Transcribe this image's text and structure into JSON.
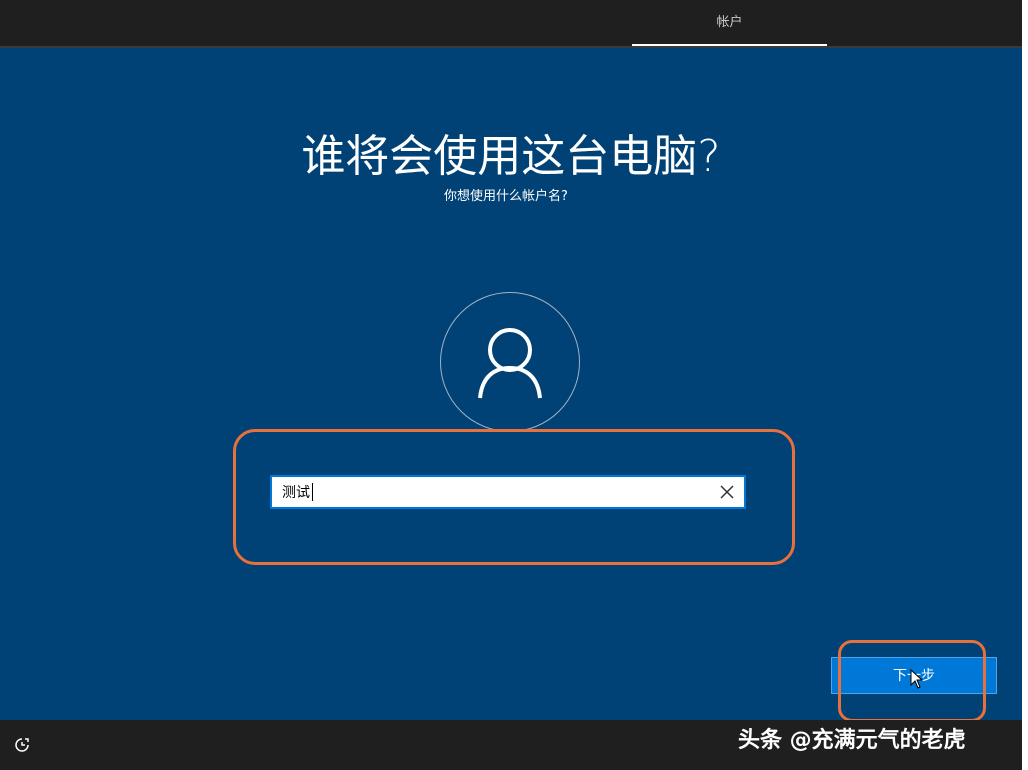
{
  "header": {
    "tab_account": "帐户"
  },
  "main": {
    "title": "谁将会使用这台电脑?",
    "subtitle": "你想使用什么帐户名?",
    "avatar_icon": "user-icon",
    "name_field": {
      "value": "测试",
      "clear_icon": "close-icon"
    },
    "next_button_label": "下一步"
  },
  "footer": {
    "ease_of_access_icon": "accessibility-icon",
    "watermark": "头条 @充满元气的老虎"
  },
  "colors": {
    "background": "#004275",
    "bar": "#1f1f1f",
    "accent": "#0078d7",
    "annotation": "#e8703a"
  }
}
